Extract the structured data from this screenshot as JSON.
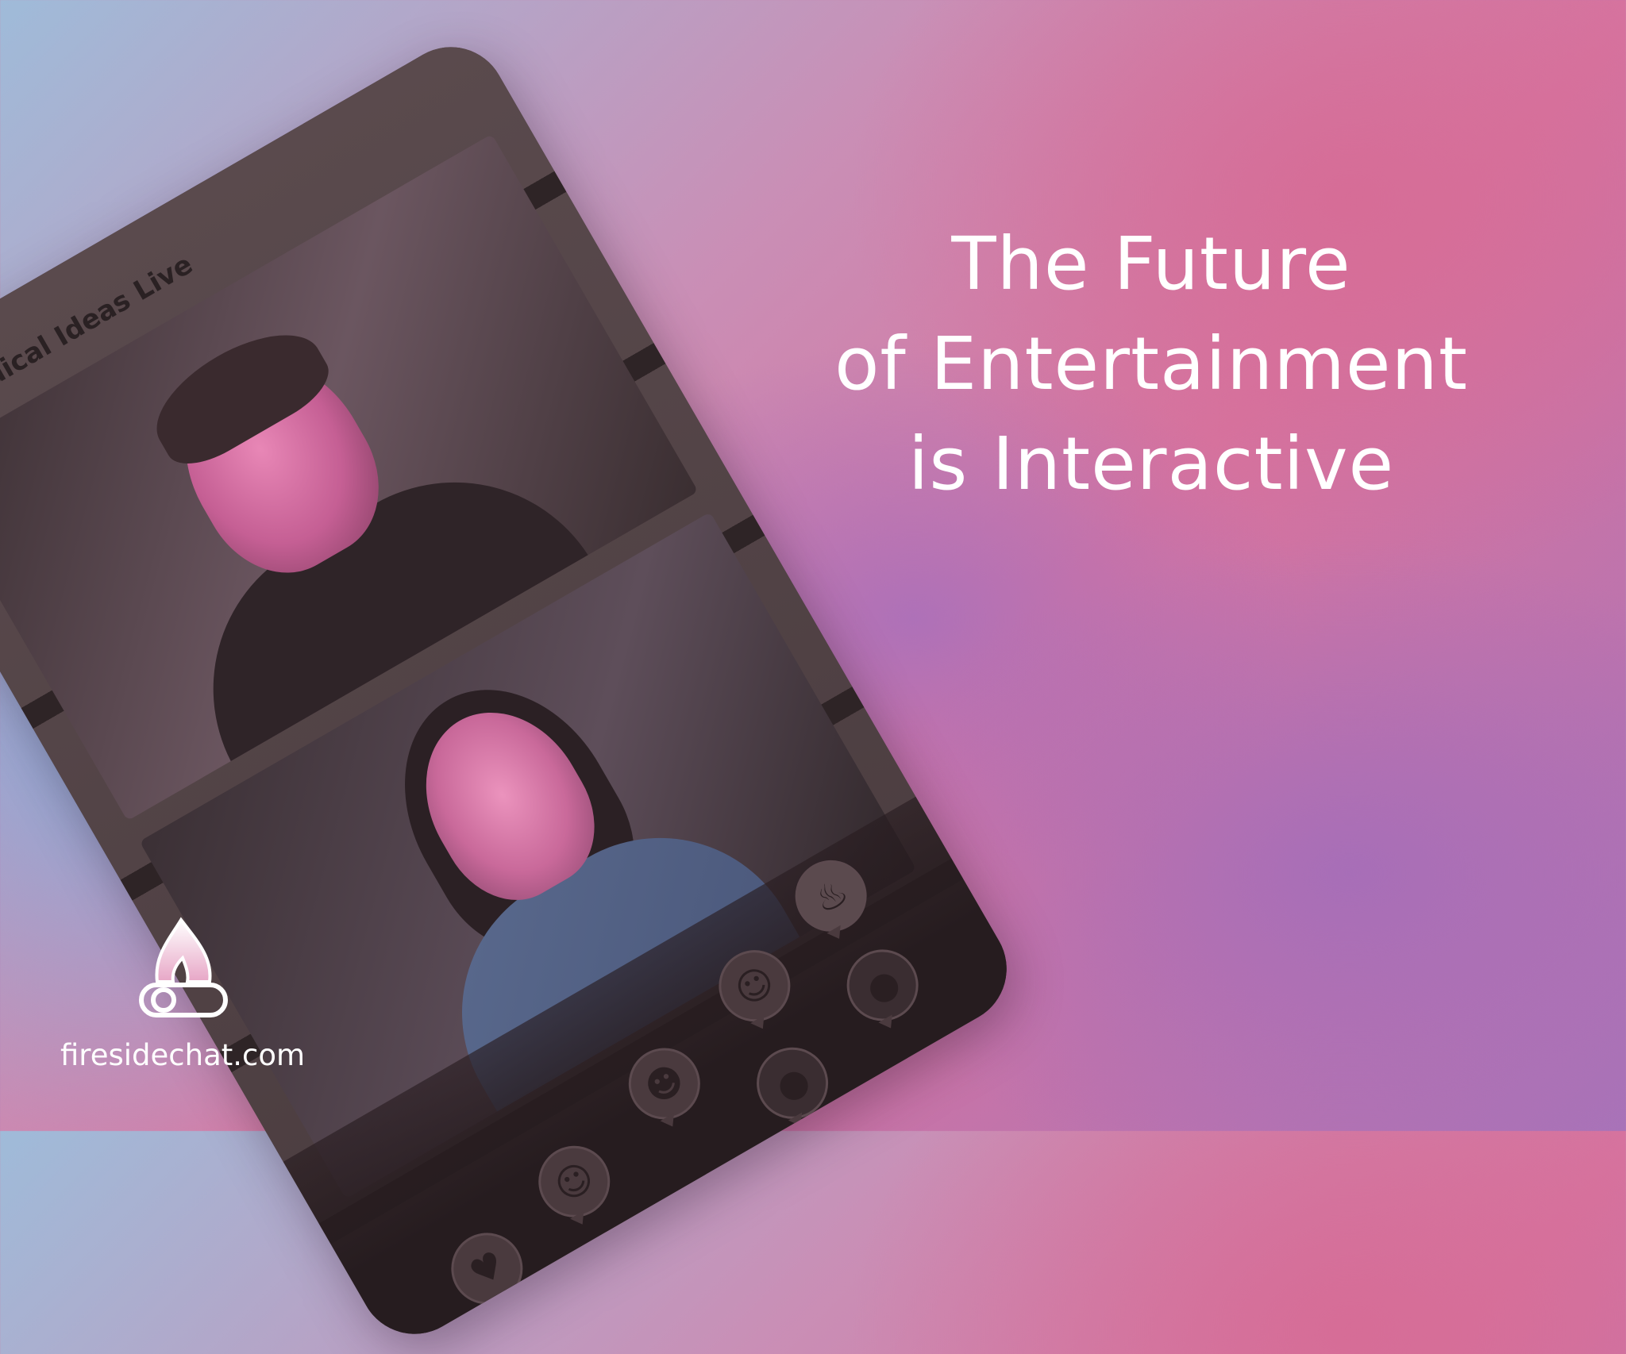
{
  "headline": {
    "line1": "The Future",
    "line2": "of Entertainment",
    "line3": "is Interactive"
  },
  "phone": {
    "app_title": "Radical Ideas Live",
    "reactions": [
      "fire-icon",
      "smile-face-icon",
      "happy-face-icon",
      "surprised-face-icon",
      "crying-face-icon",
      "ghost-face-icon",
      "heart-icon"
    ]
  },
  "brand": {
    "url": "firesidechat.com",
    "logo_icon": "flame-logo-icon"
  },
  "colors": {
    "pink": "#d674a0",
    "purple": "#a873b8",
    "blue": "#8aacd8",
    "text": "#ffffff"
  }
}
